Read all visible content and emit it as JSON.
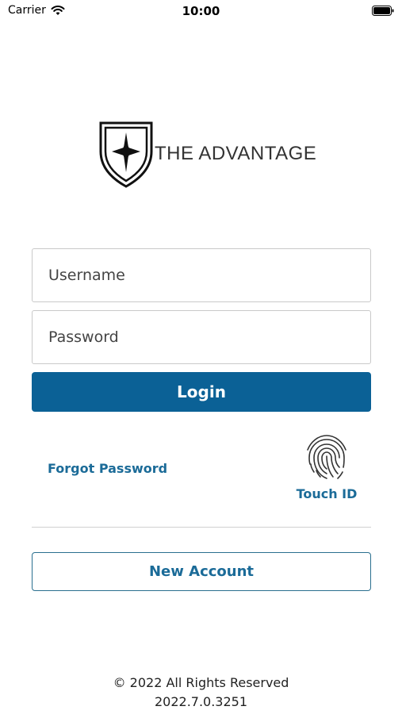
{
  "status_bar": {
    "carrier": "Carrier",
    "time": "10:00",
    "wifi_icon": "wifi-icon",
    "battery_icon": "battery-icon"
  },
  "logo": {
    "text": "THE ADVANTAGE",
    "icon": "shield-star-icon"
  },
  "login_form": {
    "username_placeholder": "Username",
    "username_value": "",
    "password_placeholder": "Password",
    "password_value": "",
    "login_label": "Login"
  },
  "links": {
    "forgot_password": "Forgot Password",
    "touch_id": "Touch ID",
    "touch_id_icon": "fingerprint-icon"
  },
  "new_account_label": "New Account",
  "footer": {
    "copyright": "© 2022 All Rights Reserved",
    "version": "2022.7.0.3251"
  },
  "colors": {
    "primary": "#0b6196",
    "link": "#1b6b98"
  }
}
